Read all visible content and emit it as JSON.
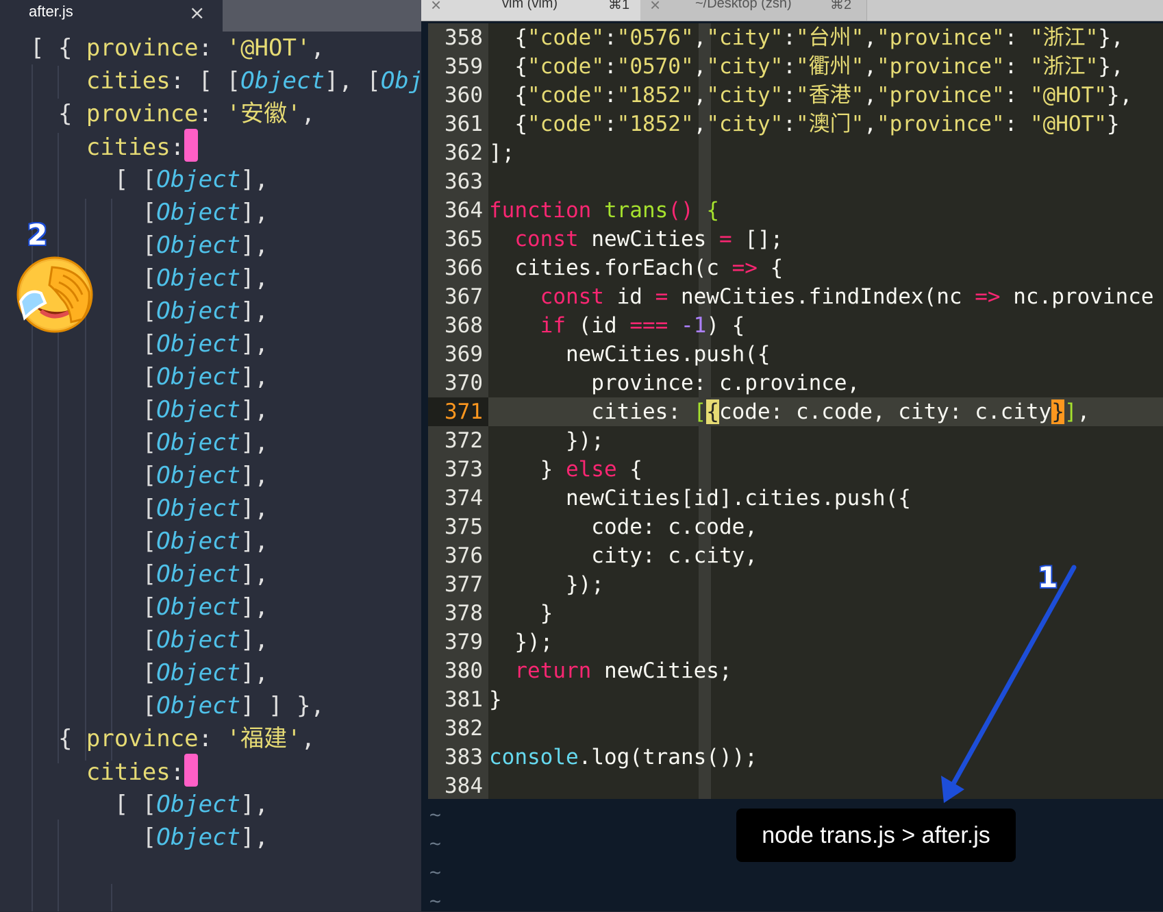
{
  "left_pane": {
    "tab_title": "after.js",
    "tab_close": "×",
    "lines": [
      {
        "t": "[ { province: '@HOT',"
      },
      {
        "t": "    cities: [ [Object], [Obj"
      },
      {
        "t": "  { province: '安徽',"
      },
      {
        "t": "    cities:"
      },
      {
        "t": "      [ [Object],"
      },
      {
        "t": "        [Object],"
      },
      {
        "t": "        [Object],"
      },
      {
        "t": "        [Object],"
      },
      {
        "t": "        [Object],"
      },
      {
        "t": "        [Object],"
      },
      {
        "t": "        [Object],"
      },
      {
        "t": "        [Object],"
      },
      {
        "t": "        [Object],"
      },
      {
        "t": "        [Object],"
      },
      {
        "t": "        [Object],"
      },
      {
        "t": "        [Object],"
      },
      {
        "t": "        [Object],"
      },
      {
        "t": "        [Object],"
      },
      {
        "t": "        [Object],"
      },
      {
        "t": "        [Object],"
      },
      {
        "t": "        [Object] ] },"
      },
      {
        "t": "  { province: '福建',"
      },
      {
        "t": "    cities:"
      },
      {
        "t": "      [ [Object],"
      },
      {
        "t": "        [Object],"
      }
    ],
    "marker_label": "2",
    "emoji_name": "facepalm-crying-emoji"
  },
  "terminal": {
    "tabs": [
      {
        "close": "×",
        "title": "vim (vim)",
        "shortcut": "⌘1",
        "active": true
      },
      {
        "close": "×",
        "title": "~/Desktop (zsh)",
        "shortcut": "⌘2",
        "active": false
      }
    ]
  },
  "editor": {
    "line_numbers": [
      "358",
      "359",
      "360",
      "361",
      "362",
      "363",
      "364",
      "365",
      "366",
      "367",
      "368",
      "369",
      "370",
      "371",
      "372",
      "373",
      "374",
      "375",
      "376",
      "377",
      "378",
      "379",
      "380",
      "381",
      "382",
      "383",
      "384"
    ],
    "current_line": "371",
    "tilde": "~",
    "code_lines": [
      "  {\"code\":\"0576\",\"city\":\"台州\",\"province\": \"浙江\"},",
      "  {\"code\":\"0570\",\"city\":\"衢州\",\"province\": \"浙江\"},",
      "  {\"code\":\"1852\",\"city\":\"香港\",\"province\": \"@HOT\"},",
      "  {\"code\":\"1852\",\"city\":\"澳门\",\"province\": \"@HOT\"}",
      "];",
      "",
      "function trans() {",
      "  const newCities = [];",
      "  cities.forEach(c => {",
      "    const id = newCities.findIndex(nc => nc.province ==",
      "    if (id === -1) {",
      "      newCities.push({",
      "        province: c.province,",
      "        cities: [{code: c.code, city: c.city}],",
      "      });",
      "    } else {",
      "      newCities[id].cities.push({",
      "        code: c.code,",
      "        city: c.city,",
      "      });",
      "    }",
      "  });",
      "  return newCities;",
      "}",
      "",
      "console.log(trans());",
      ""
    ]
  },
  "annotation": {
    "marker_label": "1",
    "command": "node trans.js > after.js",
    "arrow_color": "#1d4ed8"
  }
}
